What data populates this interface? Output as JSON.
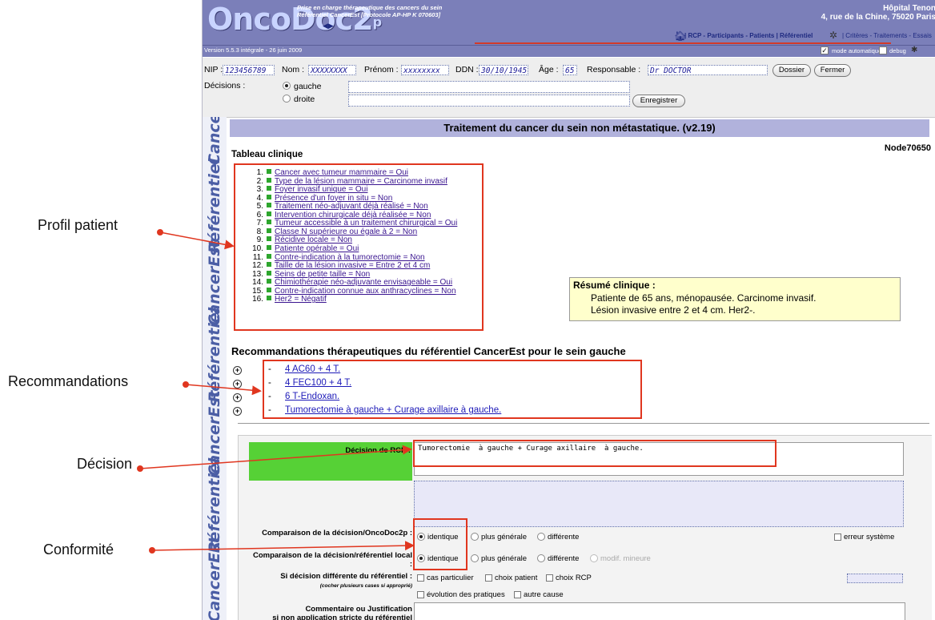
{
  "header": {
    "logo": "OncoDoc2",
    "logo_sup": "p",
    "subtitle_line1": "Prise en charge thérapeutique des cancers du sein",
    "subtitle_line2": "Référentiel CancerEst [Protocole AP-HP K 070603]",
    "hospital_name": "Hôpital Tenon",
    "hospital_address": "4, rue de la Chine, 75020 Paris",
    "nav_links": "| RCP - Participants - Patients | Référentiel",
    "nav_links2": "| Critères - Traitements - Essais",
    "version": "Version 5.5.3 intégrale - 26 juin 2009",
    "mode_auto_label": "mode automatique",
    "debug_label": "debug"
  },
  "patient": {
    "nip_label": "NIP :",
    "nip": "123456789",
    "nom_label": "Nom :",
    "nom": "XXXXXXXX",
    "prenom_label": "Prénom :",
    "prenom": "xxxxxxxx",
    "ddn_label": "DDN :",
    "ddn": "30/10/1945",
    "age_label": "Âge :",
    "age": "65",
    "responsable_label": "Responsable :",
    "responsable": "Dr DOCTOR",
    "dossier_button": "Dossier",
    "fermer_button": "Fermer",
    "decisions_label": "Décisions :",
    "gauche_label": "gauche",
    "droite_label": "droite",
    "enregistrer_button": "Enregistrer"
  },
  "sidebar": {
    "words": [
      "Cancer",
      "Référentiel",
      "CancerEst",
      "Référentiel",
      "CancerEst",
      "Référentiel",
      "CancerEst"
    ]
  },
  "main": {
    "title": "Traitement du cancer du sein non métastatique. (v2.19)",
    "node": "Node70650",
    "tableau_title": "Tableau clinique",
    "clinical_items": [
      "Cancer avec tumeur mammaire = Oui",
      "Type de la lésion mammaire = Carcinome invasif",
      "Foyer invasif unique = Oui",
      "Présence d'un foyer in situ = Non",
      "Traitement néo-adjuvant déjà réalisé = Non",
      "Intervention chirurgicale déjà réalisée = Non",
      "Tumeur accessible à un traitement chirurgical = Oui",
      "Classe N supérieure ou égale à 2 = Non",
      "Récidive locale = Non",
      "Patiente opérable = Oui",
      "Contre-indication à la tumorectomie = Non",
      "Taille de la lésion invasive = Entre 2 et 4 cm",
      "Seins de petite taille = Non",
      "Chimiothérapie néo-adjuvante envisageable = Oui",
      "Contre-indication connue aux anthracyclines = Non",
      "Her2 = Négatif"
    ],
    "resume_title": "Résumé clinique :",
    "resume_line1": "Patiente de 65 ans, ménopausée. Carcinome invasif.",
    "resume_line2": "Lésion invasive entre 2 et 4 cm. Her2-.",
    "reco_title": "Recommandations thérapeutiques du référentiel CancerEst pour le sein gauche",
    "recommendations": [
      "4 AC60 + 4 T.",
      "4 FEC100 + 4 T.",
      "6 T-Endoxan.",
      "Tumorectomie à gauche + Curage axillaire à gauche."
    ]
  },
  "form": {
    "decision_label": "Décision de RCP :",
    "decision_value": "Tumorectomie  à gauche + Curage axillaire  à gauche.",
    "comparaison_label": "Comparaison de la décision/OncoDoc2p :",
    "comparaison_local_label": "Comparaison de la décision/référentiel local :",
    "identique": "identique",
    "plus_generale": "plus générale",
    "differente": "différente",
    "modif_mineure": "modif. mineure",
    "erreur_systeme": "erreur système",
    "si_diff_label": "Si décision différente du référentiel :",
    "si_diff_hint": "(cocher plusieurs cases si approprié)",
    "cas_particulier": "cas particulier",
    "choix_patient": "choix patient",
    "choix_rcp": "choix RCP",
    "evolution": "évolution des pratiques",
    "autre_cause": "autre cause",
    "commentaire_label": "Commentaire ou Justification",
    "commentaire_label2": "si non application stricte du référentiel"
  },
  "annotations": {
    "profil": "Profil patient",
    "recommandations": "Recommandations",
    "decision": "Décision",
    "conformite": "Conformité"
  },
  "colors": {
    "header_bg": "#7b7fb9",
    "title_bar": "#b1b2dc",
    "annotation_red": "#e0361f",
    "decision_green": "#56d136",
    "resume_bg": "#ffffcc"
  }
}
